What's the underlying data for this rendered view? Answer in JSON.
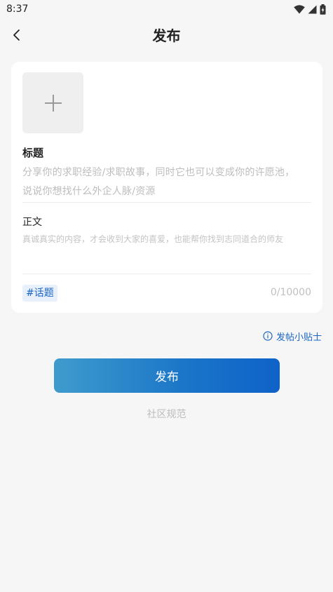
{
  "status_bar": {
    "time": "8:37",
    "icons": [
      "wifi-icon",
      "signal-icon",
      "battery-icon"
    ]
  },
  "header": {
    "title": "发布",
    "back_icon": "chevron-left-icon"
  },
  "form": {
    "image_picker_icon": "plus-icon",
    "title_label": "标题",
    "title_placeholder_line1": "分享你的求职经验/求职故事，同时它也可以变成你的许愿池，",
    "title_placeholder_line2": "说说你想找什么外企人脉/资源",
    "body_label": "正文",
    "body_placeholder": "真诚真实的内容，才会收到大家的喜爱，也能帮你找到志同道合的师友",
    "topic_tag": "#话题",
    "char_count": "0/10000"
  },
  "tips_link": "发帖小贴士",
  "publish_button": "发布",
  "community_rules_link": "社区规范",
  "colors": {
    "accent": "#1a66c4",
    "background": "#f6f6f6",
    "card": "#ffffff",
    "button_gradient_start": "#3f9bcc",
    "button_gradient_end": "#0f62c8"
  }
}
